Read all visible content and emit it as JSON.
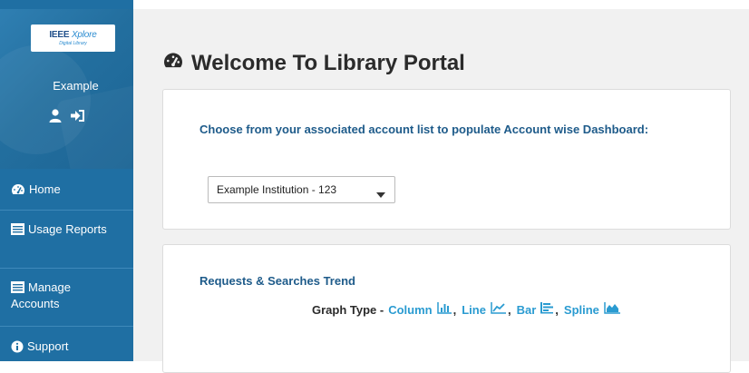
{
  "sidebar": {
    "logo": {
      "main": "IEEE",
      "italic": "Xplore",
      "sub": "Digital Library"
    },
    "user_name": "Example",
    "user_icon": "user-icon",
    "signout_icon": "sign-out-icon",
    "items": [
      {
        "label": "Home",
        "icon": "dashboard-icon"
      },
      {
        "label": "Usage Reports",
        "icon": "report-icon"
      },
      {
        "label": "Manage Accounts",
        "icon": "report-icon"
      },
      {
        "label": "Support",
        "icon": "info-icon"
      }
    ]
  },
  "main": {
    "title": "Welcome To Library Portal",
    "title_icon": "dashboard-icon",
    "account_prompt": "Choose from your associated account list to populate Account wise Dashboard:",
    "account_select": {
      "value": "Example Institution - 123"
    },
    "trend": {
      "title": "Requests & Searches Trend",
      "graph_type_label": "Graph Type -",
      "options": [
        {
          "label": "Column",
          "icon": "column-chart-icon"
        },
        {
          "label": "Line",
          "icon": "line-chart-icon"
        },
        {
          "label": "Bar",
          "icon": "bar-chart-icon"
        },
        {
          "label": "Spline",
          "icon": "area-chart-icon"
        }
      ],
      "separator": ","
    }
  },
  "colors": {
    "sidebar": "#1f6fa3",
    "heading_blue": "#1e5b8a",
    "link_blue": "#2a9bd1",
    "main_bg": "#f1f1f1"
  }
}
